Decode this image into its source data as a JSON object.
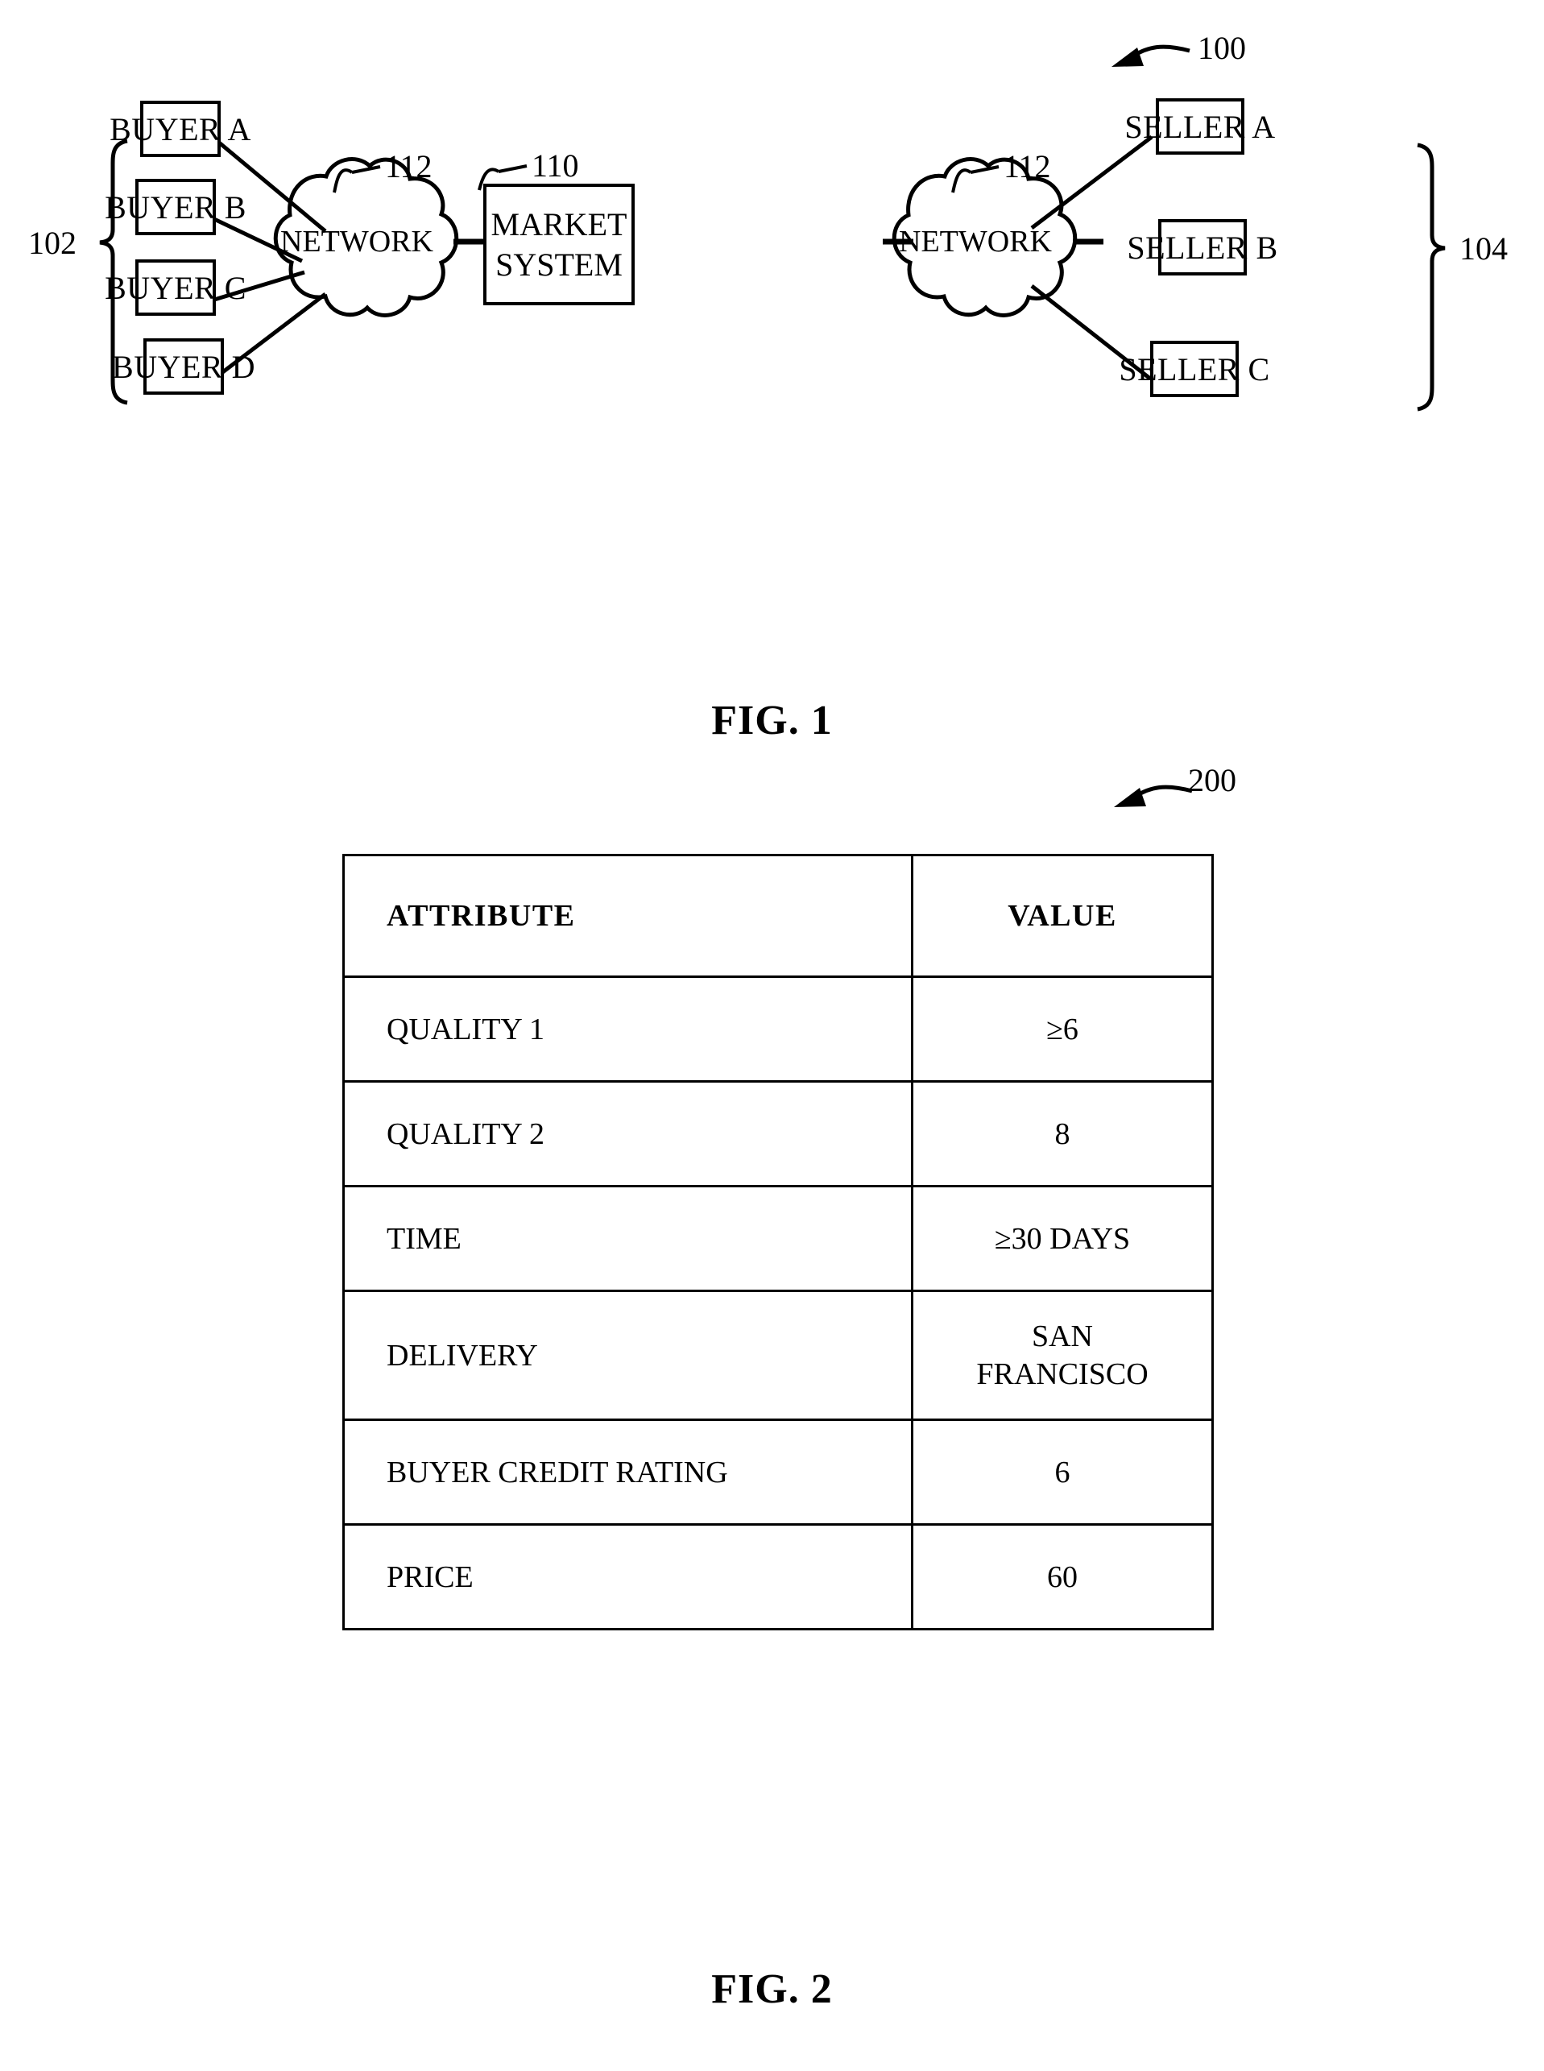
{
  "figure1": {
    "reference_number": "100",
    "caption": "FIG. 1",
    "buyers_bracket_label": "102",
    "sellers_bracket_label": "104",
    "buyers": [
      {
        "label": "BUYER A"
      },
      {
        "label": "BUYER B"
      },
      {
        "label": "BUYER C"
      },
      {
        "label": "BUYER D"
      }
    ],
    "sellers": [
      {
        "label": "SELLER A"
      },
      {
        "label": "SELLER B"
      },
      {
        "label": "SELLER C"
      }
    ],
    "network_left": {
      "label": "NETWORK",
      "reference_number": "112"
    },
    "network_right": {
      "label": "NETWORK",
      "reference_number": "112"
    },
    "market_system": {
      "line1": "MARKET",
      "line2": "SYSTEM",
      "reference_number": "110"
    }
  },
  "figure2": {
    "reference_number": "200",
    "caption": "FIG. 2",
    "table": {
      "headers": [
        "ATTRIBUTE",
        "VALUE"
      ],
      "rows": [
        {
          "attribute": "QUALITY 1",
          "value": "≥6"
        },
        {
          "attribute": "QUALITY 2",
          "value": "8"
        },
        {
          "attribute": "TIME",
          "value": "≥30 DAYS"
        },
        {
          "attribute": "DELIVERY",
          "value_line1": "SAN",
          "value_line2": "FRANCISCO"
        },
        {
          "attribute": "BUYER CREDIT RATING",
          "value": "6"
        },
        {
          "attribute": "PRICE",
          "value": "60"
        }
      ]
    }
  }
}
